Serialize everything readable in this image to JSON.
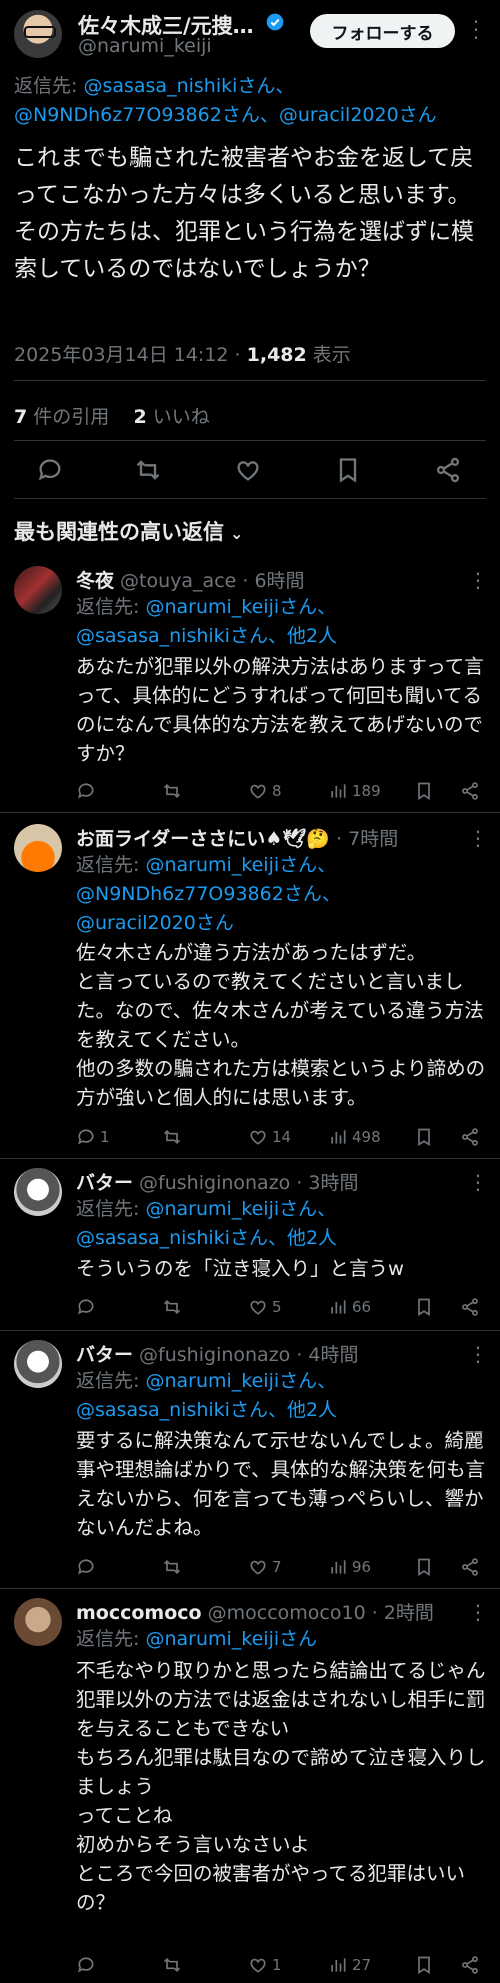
{
  "tweet": {
    "author_name": "佐々木成三/元捜…",
    "author_handle": "@narumi_keiji",
    "follow_label": "フォローする",
    "reply_to_prefix": "返信先: ",
    "reply_to_mentions": [
      "@sasasa_nishikiさん、",
      "@N9NDh6z77O93862さん、",
      "@uracil2020さん"
    ],
    "text": "これまでも騙された被害者やお金を返して戻ってこなかった方々は多くいると思います。\nその方たちは、犯罪という行為を選ばずに模索しているのではないでしょうか？",
    "timestamp": "2025年03月14日 14:12 · ",
    "views_count": "1,482",
    "views_label": " 表示",
    "quotes_count": "7",
    "quotes_label": " 件の引用",
    "likes_count": "2",
    "likes_label": " いいね"
  },
  "sort_label": "最も関連性の高い返信",
  "replies": [
    {
      "name": "冬夜",
      "handle": " @touya_ace · 6時間",
      "reply_prefix": "返信先: ",
      "mentions": "@narumi_keijiさん、\n@sasasa_nishikiさん、他2人",
      "text": "あなたが犯罪以外の解決方法はありますって言って、具体的にどうすればって何回も聞いてるのになんで具体的な方法を教えてあげないのですか？",
      "replies_count": "",
      "likes": "8",
      "views": "189"
    },
    {
      "name": "お面ライダーささにい♠🕊🤔",
      "handle": " · 7時間",
      "reply_prefix": "返信先: ",
      "mentions": "@narumi_keijiさん、\n@N9NDh6z77O93862さん、\n@uracil2020さん",
      "text": "佐々木さんが違う方法があったはずだ。\nと言っているので教えてくださいと言いました。なので、佐々木さんが考えている違う方法を教えてください。\n他の多数の騙された方は模索というより諦めの方が強いと個人的には思います。",
      "replies_count": "1",
      "likes": "14",
      "views": "498"
    },
    {
      "name": "バター",
      "handle": " @fushiginonazo · 3時間",
      "reply_prefix": "返信先: ",
      "mentions": "@narumi_keijiさん、\n@sasasa_nishikiさん、他2人",
      "text": "そういうのを「泣き寝入り」と言うw",
      "replies_count": "",
      "likes": "5",
      "views": "66"
    },
    {
      "name": "バター",
      "handle": " @fushiginonazo · 4時間",
      "reply_prefix": "返信先: ",
      "mentions": "@narumi_keijiさん、\n@sasasa_nishikiさん、他2人",
      "text": "要するに解決策なんて示せないんでしょ。綺麗事や理想論ばかりで、具体的な解決策を何も言えないから、何を言っても薄っぺらいし、響かないんだよね。",
      "replies_count": "",
      "likes": "7",
      "views": "96"
    },
    {
      "name": "moccomoco",
      "handle": " @moccomoco10 · 2時間",
      "reply_prefix": "返信先: ",
      "mentions": "@narumi_keijiさん",
      "text": "不毛なやり取りかと思ったら結論出てるじゃん\n犯罪以外の方法では返金はされないし相手に罰を与えることもできない\nもちろん犯罪は駄目なので諦めて泣き寝入りしましょう\nってことね\n初めからそう言いなさいよ\nところで今回の被害者がやってる犯罪はいいの？",
      "replies_count": "",
      "likes": "1",
      "views": "27"
    }
  ]
}
